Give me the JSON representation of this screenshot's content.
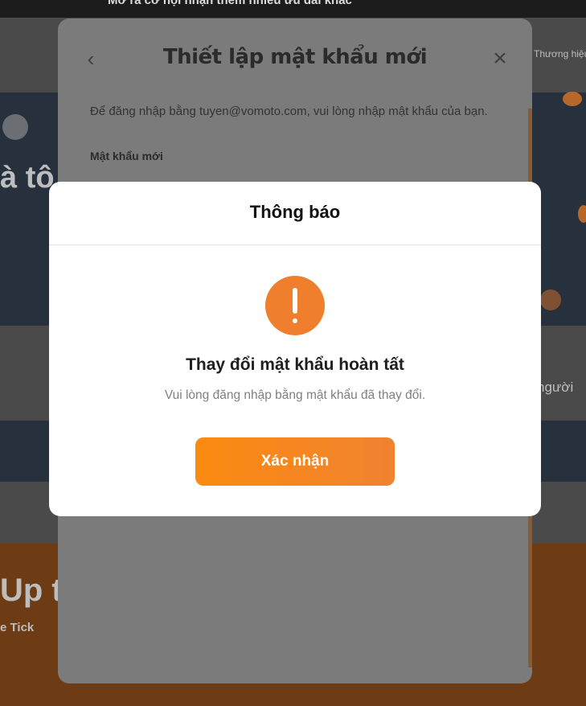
{
  "background": {
    "top_banner_text": "Mở ra cơ hội nhận thêm nhiều ưu đãi khác",
    "hero_text": "à tô",
    "promo_text": "Up t",
    "promo_subtext": "e Tick",
    "side_text_1": "Thương hiệu",
    "side_text_2": "người"
  },
  "password_modal": {
    "back_icon": "chevron-left-icon",
    "close_icon": "close-icon",
    "title": "Thiết lập mật khẩu mới",
    "description": "Để đăng nhập bằng tuyen@vomoto.com, vui lòng nhập mật khẩu của bạn.",
    "new_password_label": "Mật khẩu mới"
  },
  "dialog": {
    "title": "Thông báo",
    "icon": "exclamation-icon",
    "heading": "Thay đổi mật khẩu hoàn tất",
    "message": "Vui lòng đăng nhập bằng mật khẩu đã thay đổi.",
    "confirm_label": "Xác nhận"
  },
  "colors": {
    "accent": "#f08230",
    "overlay": "#3a3a3a"
  }
}
